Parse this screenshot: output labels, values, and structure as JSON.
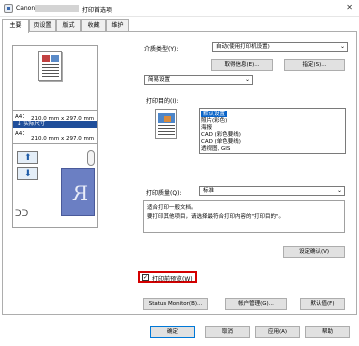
{
  "window": {
    "brand": "Canon",
    "title": "打印首选项",
    "close_glyph": "✕"
  },
  "tabs": [
    {
      "label": "主要"
    },
    {
      "label": "页设置"
    },
    {
      "label": "版式"
    },
    {
      "label": "收藏"
    },
    {
      "label": "维护"
    }
  ],
  "preview": {
    "paper_row1": "A4：",
    "paper_row2": "210.0 mm x 297.0 mm",
    "actual_size": "↓ 实际尺寸",
    "paper_row3": "A4：",
    "paper_row4": "210.0 mm x 297.0 mm",
    "output_glyph": "R",
    "glasses_glyph": "ᑐᑐ"
  },
  "media_type": {
    "label": "介质类型(Y):",
    "value": "自动(使用打印机设置)"
  },
  "buttons": {
    "get_info": "取得信息(E)...",
    "specify": "指定(S)...",
    "quality_confirm": "设定确认(V)",
    "status_monitor": "Status Monitor(B)...",
    "account_manage": "帐户管理(G)...",
    "defaults": "默认值(F)",
    "ok": "确定",
    "cancel": "取消",
    "apply": "应用(A)",
    "help": "帮助"
  },
  "settings_mode": {
    "value": "简易设置"
  },
  "print_purpose": {
    "label": "打印目的(I):",
    "items": [
      "默认设置",
      "照片(彩色)",
      "海报",
      "CAD (彩色要线)",
      "CAD (单色要线)",
      "透视图, GIS"
    ],
    "selected_index": 0
  },
  "print_quality": {
    "label": "打印质量(Q):",
    "value": "标准"
  },
  "description": {
    "line1": "适合打印一般文档。",
    "line2": "要打印其他项目，请选择最符合打印内容的\"打印目的\"。"
  },
  "preview_before_print": {
    "label": "打印前预览(W)",
    "checked": true
  },
  "colors": {
    "accent_blue": "#0a64c8",
    "highlight_red": "#d40000"
  }
}
